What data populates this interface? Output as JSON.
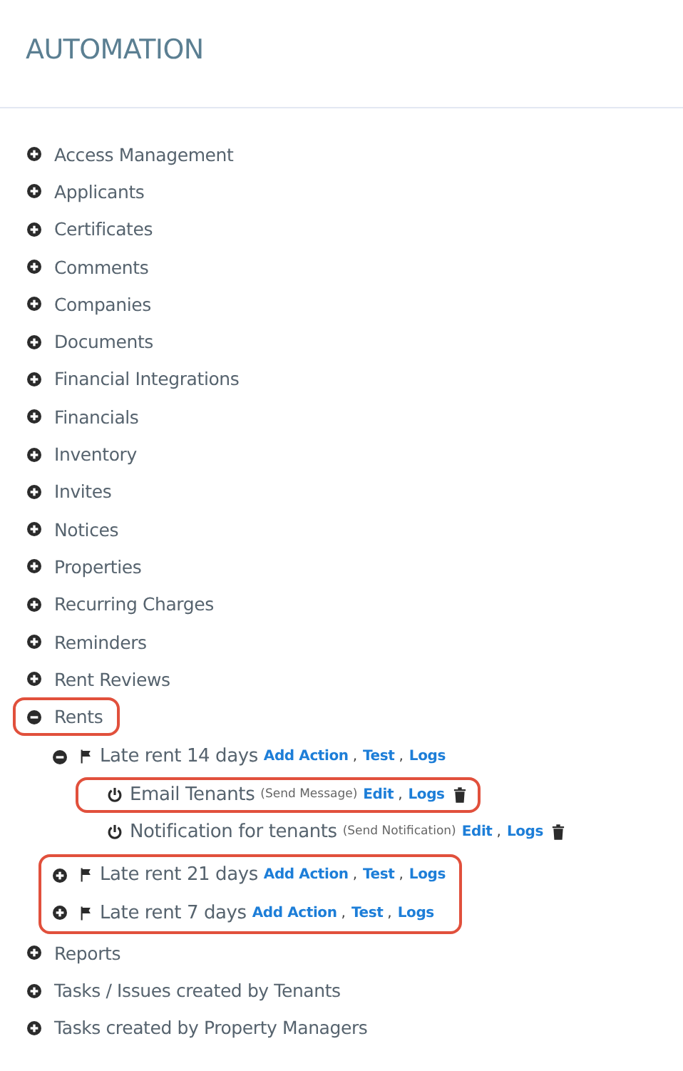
{
  "title": "AUTOMATION",
  "categories": [
    {
      "label": "Access Management",
      "expanded": false,
      "highlighted": false
    },
    {
      "label": "Applicants",
      "expanded": false,
      "highlighted": false
    },
    {
      "label": "Certificates",
      "expanded": false,
      "highlighted": false
    },
    {
      "label": "Comments",
      "expanded": false,
      "highlighted": false
    },
    {
      "label": "Companies",
      "expanded": false,
      "highlighted": false
    },
    {
      "label": "Documents",
      "expanded": false,
      "highlighted": false
    },
    {
      "label": "Financial Integrations",
      "expanded": false,
      "highlighted": false
    },
    {
      "label": "Financials",
      "expanded": false,
      "highlighted": false
    },
    {
      "label": "Inventory",
      "expanded": false,
      "highlighted": false
    },
    {
      "label": "Invites",
      "expanded": false,
      "highlighted": false
    },
    {
      "label": "Notices",
      "expanded": false,
      "highlighted": false
    },
    {
      "label": "Properties",
      "expanded": false,
      "highlighted": false
    },
    {
      "label": "Recurring Charges",
      "expanded": false,
      "highlighted": false
    },
    {
      "label": "Reminders",
      "expanded": false,
      "highlighted": false
    },
    {
      "label": "Rent Reviews",
      "expanded": false,
      "highlighted": false
    },
    {
      "label": "Rents",
      "expanded": true,
      "highlighted": true,
      "rules": [
        {
          "label": "Late rent 14 days",
          "expanded": true,
          "highlighted": false,
          "links": [
            {
              "label": "Add Action",
              "separator": ","
            },
            {
              "label": "Test",
              "separator": ","
            },
            {
              "label": "Logs"
            }
          ],
          "actions": [
            {
              "name": "Email Tenants",
              "type": "(Send Message)",
              "highlighted": true,
              "links": [
                {
                  "label": "Edit",
                  "separator": ","
                },
                {
                  "label": "Logs"
                }
              ]
            },
            {
              "name": "Notification for tenants",
              "type": "(Send Notification)",
              "highlighted": false,
              "links": [
                {
                  "label": "Edit",
                  "separator": ","
                },
                {
                  "label": "Logs"
                }
              ]
            }
          ]
        },
        {
          "label": "Late rent 21 days",
          "expanded": false,
          "highlighted": true,
          "links": [
            {
              "label": "Add Action",
              "separator": ","
            },
            {
              "label": "Test",
              "separator": ","
            },
            {
              "label": "Logs"
            }
          ]
        },
        {
          "label": "Late rent 7 days",
          "expanded": false,
          "highlighted": true,
          "links": [
            {
              "label": "Add Action",
              "separator": ","
            },
            {
              "label": "Test",
              "separator": ","
            },
            {
              "label": "Logs"
            }
          ]
        }
      ]
    },
    {
      "label": "Reports",
      "expanded": false,
      "highlighted": false
    },
    {
      "label": "Tasks / Issues created by Tenants",
      "expanded": false,
      "highlighted": false
    },
    {
      "label": "Tasks created by Property Managers",
      "expanded": false,
      "highlighted": false
    }
  ]
}
